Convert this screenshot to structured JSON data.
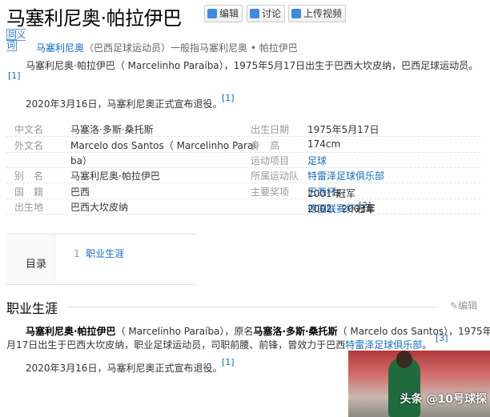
{
  "title": "马塞利尼奥·帕拉伊巴",
  "buttons": {
    "edit": "编辑",
    "discuss": "讨论",
    "upload_video": "上传视频"
  },
  "synonym": {
    "badge": "同义词",
    "link": "马塞利尼奥",
    "text": "（巴西足球运动员）一般指马塞利尼奥 • 帕拉伊巴"
  },
  "summary": {
    "p1": "马塞利尼奥·帕拉伊巴（ Marcelinho Paraíba），1975年5月17日出生于巴西大坎皮纳，巴西足球运动员。",
    "p1_ref": "[1]",
    "p2": "2020年3月16日，马塞利尼奥正式宣布退役。",
    "p2_ref": "[1]"
  },
  "infobox": {
    "left": [
      {
        "label": "中文名",
        "value": "马塞洛·多斯·桑托斯"
      },
      {
        "label": "外文名",
        "value": "Marcelo dos Santos（ Marcelinho Paraí"
      },
      {
        "label": "",
        "value": "ba）"
      },
      {
        "label": "别　名",
        "value": "马塞利尼奥·帕拉伊巴"
      },
      {
        "label": "国　籍",
        "value": "巴西"
      },
      {
        "label": "出生地",
        "value": "巴西大坎皮纳"
      }
    ],
    "right": [
      {
        "label": "出生日期",
        "value": "1975年5月17日"
      },
      {
        "label": "身　高",
        "value": "174cm"
      },
      {
        "label": "运动项目",
        "link": "足球"
      },
      {
        "label": "所属运动队",
        "link": "特雷泽足球俱乐部"
      },
      {
        "label": "主要奖项",
        "pre": "2001年",
        "link": "巴西杯",
        "post": "冠军"
      },
      {
        "label": "",
        "pre": "2002、2003年",
        "link": "德国联赛杯",
        "post": "冠军",
        "ref": "[2]"
      }
    ]
  },
  "toc": {
    "label": "目录",
    "items": [
      {
        "num": "1",
        "text": "职业生涯"
      }
    ]
  },
  "career": {
    "heading": "职业生涯",
    "edit": "编辑",
    "name_bold": "马塞利尼奥·帕拉伊巴",
    "t1": "（ Marcelinho Paraíba），原名",
    "orig_bold": "马塞洛·多斯·桑托斯",
    "t2": "（ Marcelo dos Santos），1975年5",
    "t3": "月17日出生于巴西大坎皮纳，职业足球运动员，司职前腰、前锋，曾效力于巴西",
    "club_link": "特雷泽足球俱乐部",
    "t4": "。",
    "ref": "[3]",
    "p2": "2020年3月16日，马塞利尼奥正式宣布退役。",
    "p2_ref": "[1]"
  },
  "image": {
    "watermark": "头条 @10号球探"
  }
}
